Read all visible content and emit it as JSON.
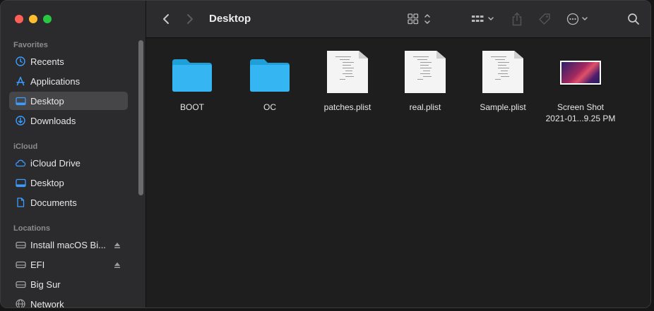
{
  "sidebar": {
    "favorites_title": "Favorites",
    "favorites": [
      {
        "label": "Recents",
        "icon": "clock-icon"
      },
      {
        "label": "Applications",
        "icon": "applications-icon"
      },
      {
        "label": "Desktop",
        "icon": "desktop-icon",
        "selected": true
      },
      {
        "label": "Downloads",
        "icon": "download-icon"
      }
    ],
    "icloud_title": "iCloud",
    "icloud": [
      {
        "label": "iCloud Drive",
        "icon": "cloud-icon"
      },
      {
        "label": "Desktop",
        "icon": "desktop-icon"
      },
      {
        "label": "Documents",
        "icon": "document-icon"
      }
    ],
    "locations_title": "Locations",
    "locations": [
      {
        "label": "Install macOS Bi...",
        "icon": "disk-icon",
        "ejectable": true
      },
      {
        "label": "EFI",
        "icon": "disk-icon",
        "ejectable": true
      },
      {
        "label": "Big Sur",
        "icon": "disk-icon"
      },
      {
        "label": "Network",
        "icon": "network-icon"
      }
    ]
  },
  "toolbar": {
    "title": "Desktop"
  },
  "files": [
    {
      "name": "BOOT",
      "kind": "folder"
    },
    {
      "name": "OC",
      "kind": "folder"
    },
    {
      "name": "patches.plist",
      "kind": "document"
    },
    {
      "name": "real.plist",
      "kind": "document"
    },
    {
      "name": "Sample.plist",
      "kind": "document"
    },
    {
      "name_line1": "Screen Shot",
      "name_line2": "2021-01...9.25 PM",
      "kind": "screenshot"
    }
  ],
  "colors": {
    "accent": "#3b9cff",
    "folder": "#35b6f2",
    "sidebar_bg": "#2b2b2d",
    "content_bg": "#1e1e1e"
  }
}
